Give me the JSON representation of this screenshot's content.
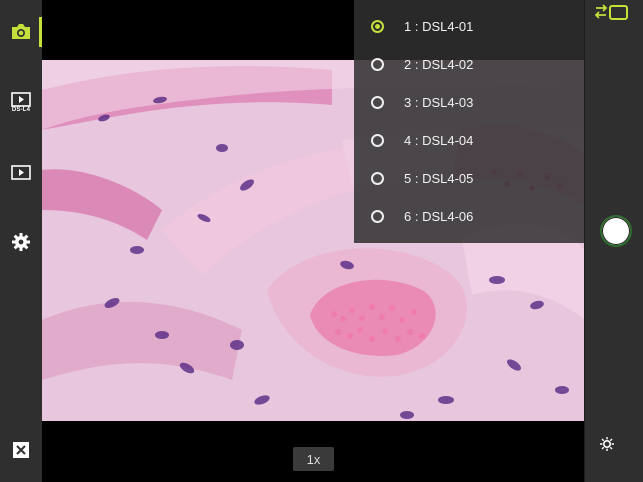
{
  "left_toolbar": {
    "camera": "camera-icon",
    "ds_player": "play-icon",
    "ds_label": "DS-L4",
    "player": "play-icon",
    "settings": "gear-icon",
    "close": "close-icon"
  },
  "zoom": {
    "label": "1x"
  },
  "camera_menu": {
    "items": [
      {
        "label": "1 : DSL4-01",
        "selected": true
      },
      {
        "label": "2 : DSL4-02",
        "selected": false
      },
      {
        "label": "3 : DSL4-03",
        "selected": false
      },
      {
        "label": "4 : DSL4-04",
        "selected": false
      },
      {
        "label": "5 : DSL4-05",
        "selected": false
      },
      {
        "label": "6 : DSL4-06",
        "selected": false
      }
    ]
  },
  "right_toolbar": {
    "switch": "switch-camera-icon",
    "shutter": "shutter-button",
    "brightness": "brightness-icon"
  },
  "colors": {
    "accent": "#c5df3b",
    "panel": "#2f2f2f",
    "tissue": "#e7c3dc",
    "nucleus": "#5a2d86"
  }
}
